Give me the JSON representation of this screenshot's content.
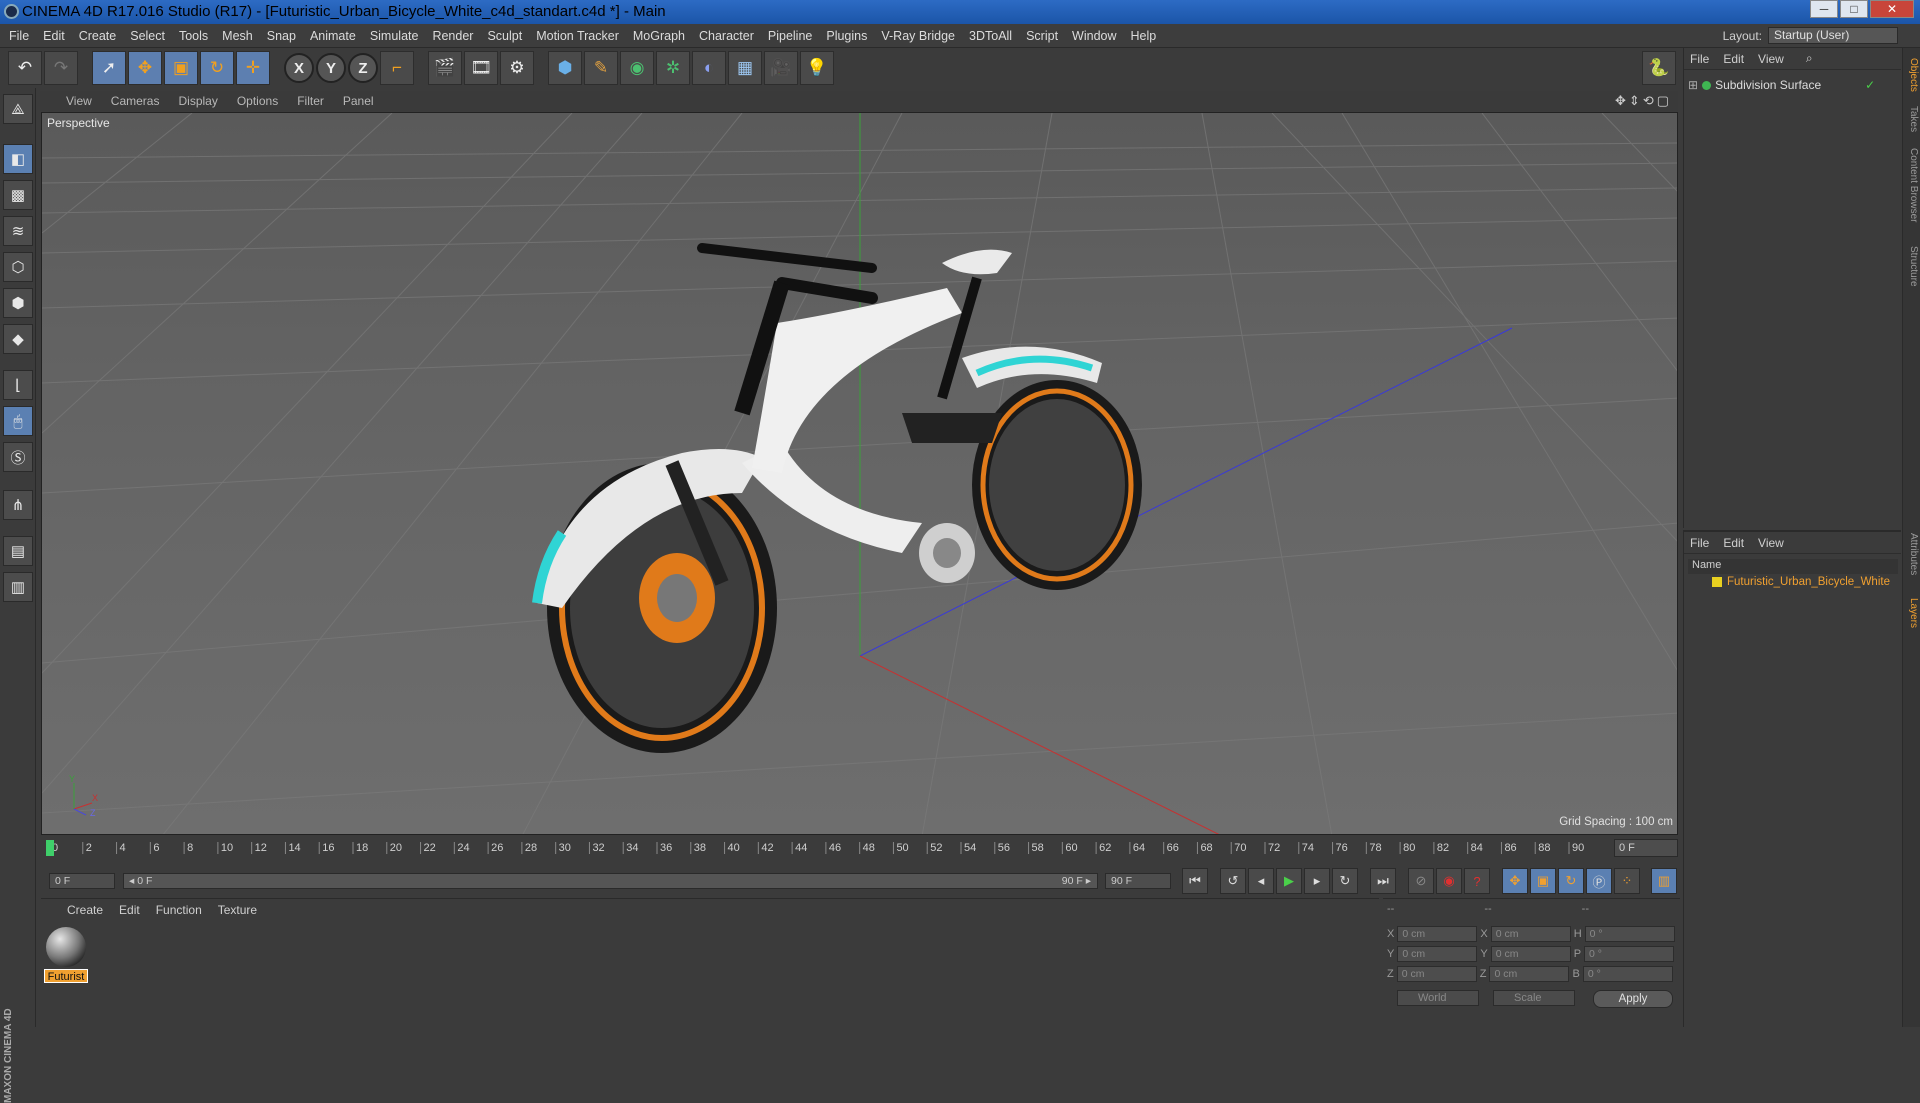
{
  "titlebar": {
    "title": "CINEMA 4D R17.016 Studio (R17) - [Futuristic_Urban_Bicycle_White_c4d_standart.c4d *] - Main"
  },
  "window_controls": {
    "minimize": "─",
    "maximize": "□",
    "close": "✕"
  },
  "menubar": {
    "items": [
      "File",
      "Edit",
      "Create",
      "Select",
      "Tools",
      "Mesh",
      "Snap",
      "Animate",
      "Simulate",
      "Render",
      "Sculpt",
      "Motion Tracker",
      "MoGraph",
      "Character",
      "Pipeline",
      "Plugins",
      "V-Ray Bridge",
      "3DToAll",
      "Script",
      "Window",
      "Help"
    ]
  },
  "layout": {
    "label": "Layout:",
    "value": "Startup (User)"
  },
  "toolbar": {
    "undo_icon": "undo-icon",
    "redo_icon": "redo-icon",
    "axis_x": "X",
    "axis_y": "Y",
    "axis_z": "Z"
  },
  "viewport": {
    "menu": [
      "View",
      "Cameras",
      "Display",
      "Options",
      "Filter",
      "Panel"
    ],
    "label": "Perspective",
    "grid_spacing": "Grid Spacing : 100 cm",
    "axis_x": "X",
    "axis_y": "Y",
    "axis_z": "Z"
  },
  "timeline": {
    "ticks": [
      "0",
      "2",
      "4",
      "6",
      "8",
      "10",
      "12",
      "14",
      "16",
      "18",
      "20",
      "22",
      "24",
      "26",
      "28",
      "30",
      "32",
      "34",
      "36",
      "38",
      "40",
      "42",
      "44",
      "46",
      "48",
      "50",
      "52",
      "54",
      "56",
      "58",
      "60",
      "62",
      "64",
      "66",
      "68",
      "70",
      "72",
      "74",
      "76",
      "78",
      "80",
      "82",
      "84",
      "86",
      "88",
      "90"
    ],
    "current_frame": "0 F"
  },
  "transport": {
    "start_field": "0 F",
    "range_start": "◂ 0 F",
    "range_end": "90 F ▸",
    "end_field": "90 F"
  },
  "material_panel": {
    "menu": [
      "Create",
      "Edit",
      "Function",
      "Texture"
    ],
    "material_name": "Futurist"
  },
  "coordinates": {
    "header": [
      "--",
      "--",
      "--"
    ],
    "rows": [
      {
        "a": "X",
        "av": "0 cm",
        "b": "X",
        "bv": "0 cm",
        "c": "H",
        "cv": "0 °"
      },
      {
        "a": "Y",
        "av": "0 cm",
        "b": "Y",
        "bv": "0 cm",
        "c": "P",
        "cv": "0 °"
      },
      {
        "a": "Z",
        "av": "0 cm",
        "b": "Z",
        "bv": "0 cm",
        "c": "B",
        "cv": "0 °"
      }
    ],
    "world": "World",
    "scale": "Scale",
    "apply": "Apply"
  },
  "object_manager": {
    "menu": [
      "File",
      "Edit",
      "View"
    ],
    "object": "Subdivision Surface"
  },
  "layer_manager": {
    "menu": [
      "File",
      "Edit",
      "View"
    ],
    "header": "Name",
    "layer": "Futuristic_Urban_Bicycle_White"
  },
  "side_tabs": [
    "Objects",
    "Takes",
    "Content Browser",
    "Structure",
    "Attributes",
    "Layers"
  ],
  "maxon_logo": "MAXON CINEMA 4D",
  "colors": {
    "accent": "#f0a030",
    "selected_tool": "#5b80b2",
    "titlebar": "#1b55a8"
  }
}
